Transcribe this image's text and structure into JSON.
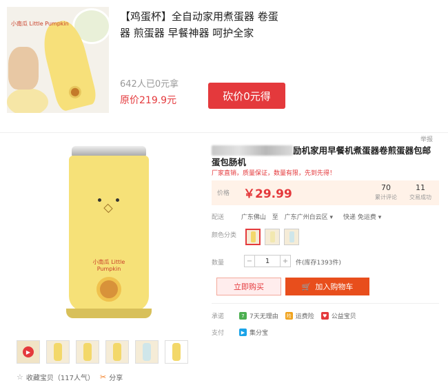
{
  "promo": {
    "image_brand": "小南瓜 Little Pumpkin",
    "title": "【鸡蛋杯】全自动家用煮蛋器 卷蛋器 煎蛋器 早餐神器 呵护全家",
    "count_text": "642人已0元拿",
    "original_price": "原价219.9元",
    "cut_button": "砍价0元得"
  },
  "product": {
    "report_label": "举报",
    "title_visible": "励机家用早餐机煮蛋器卷煎蛋器包邮蛋包肠机",
    "subtitle": "厂家直销，质量保证，数量有限，先到先得！",
    "price_label": "价格",
    "price": "￥29.99",
    "reviews_count": "70",
    "reviews_label": "累计评论",
    "sales_count": "11",
    "sales_label": "交易成功",
    "ship_label": "配送",
    "ship_from": "广东佛山",
    "ship_to_word": "至",
    "ship_to": "广东广州白云区",
    "ship_method": "快递 免运费",
    "color_label": "颜色分类",
    "qty_label": "数量",
    "qty_value": "1",
    "stock_text": "件(库存1393件)",
    "buy_now": "立即购买",
    "add_cart": "加入购物车",
    "promise_label": "承诺",
    "promises": [
      "7天无理由",
      "运费险",
      "公益宝贝"
    ],
    "pay_label": "支付",
    "pay_method": "集分宝",
    "collect_text": "收藏宝贝（117人气）",
    "share_text": "分享",
    "machine_logo": "小南瓜 Little Pumpkin"
  },
  "colors": {
    "accent": "#e4393c",
    "cart": "#e84e1c",
    "machine": "#f6e178"
  }
}
